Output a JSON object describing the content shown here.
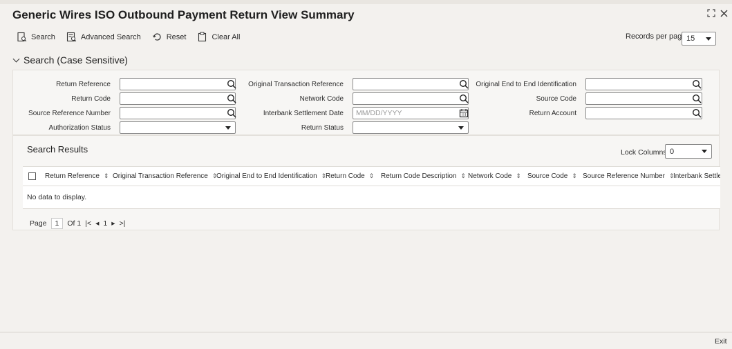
{
  "title": "Generic Wires ISO Outbound Payment Return View Summary",
  "toolbar": {
    "search": "Search",
    "advanced_search": "Advanced Search",
    "reset": "Reset",
    "clear_all": "Clear All"
  },
  "records_per_page": {
    "label": "Records per page",
    "value": "15"
  },
  "section": {
    "label": "Search (Case Sensitive)"
  },
  "fields": {
    "return_reference": "Return Reference",
    "original_transaction_reference": "Original Transaction Reference",
    "original_end_to_end_identification": "Original End to End Identification",
    "return_code": "Return Code",
    "network_code": "Network Code",
    "source_code": "Source Code",
    "source_reference_number": "Source Reference Number",
    "interbank_settlement_date": "Interbank Settlement Date",
    "interbank_settlement_date_placeholder": "MM/DD/YYYY",
    "return_account": "Return Account",
    "authorization_status": "Authorization Status",
    "return_status": "Return Status"
  },
  "results": {
    "title": "Search Results",
    "lock_columns_label": "Lock Columns",
    "lock_columns_value": "0",
    "columns": [
      "Return Reference",
      "Original Transaction Reference",
      "Original End to End Identification",
      "Return Code",
      "Return Code Description",
      "Network Code",
      "Source Code",
      "Source Reference Number",
      "Interbank Settlem"
    ],
    "no_data": "No data to display.",
    "pager": {
      "page_label": "Page",
      "page_value": "1",
      "of": "Of 1",
      "current": "1"
    }
  },
  "footer": {
    "exit": "Exit"
  }
}
